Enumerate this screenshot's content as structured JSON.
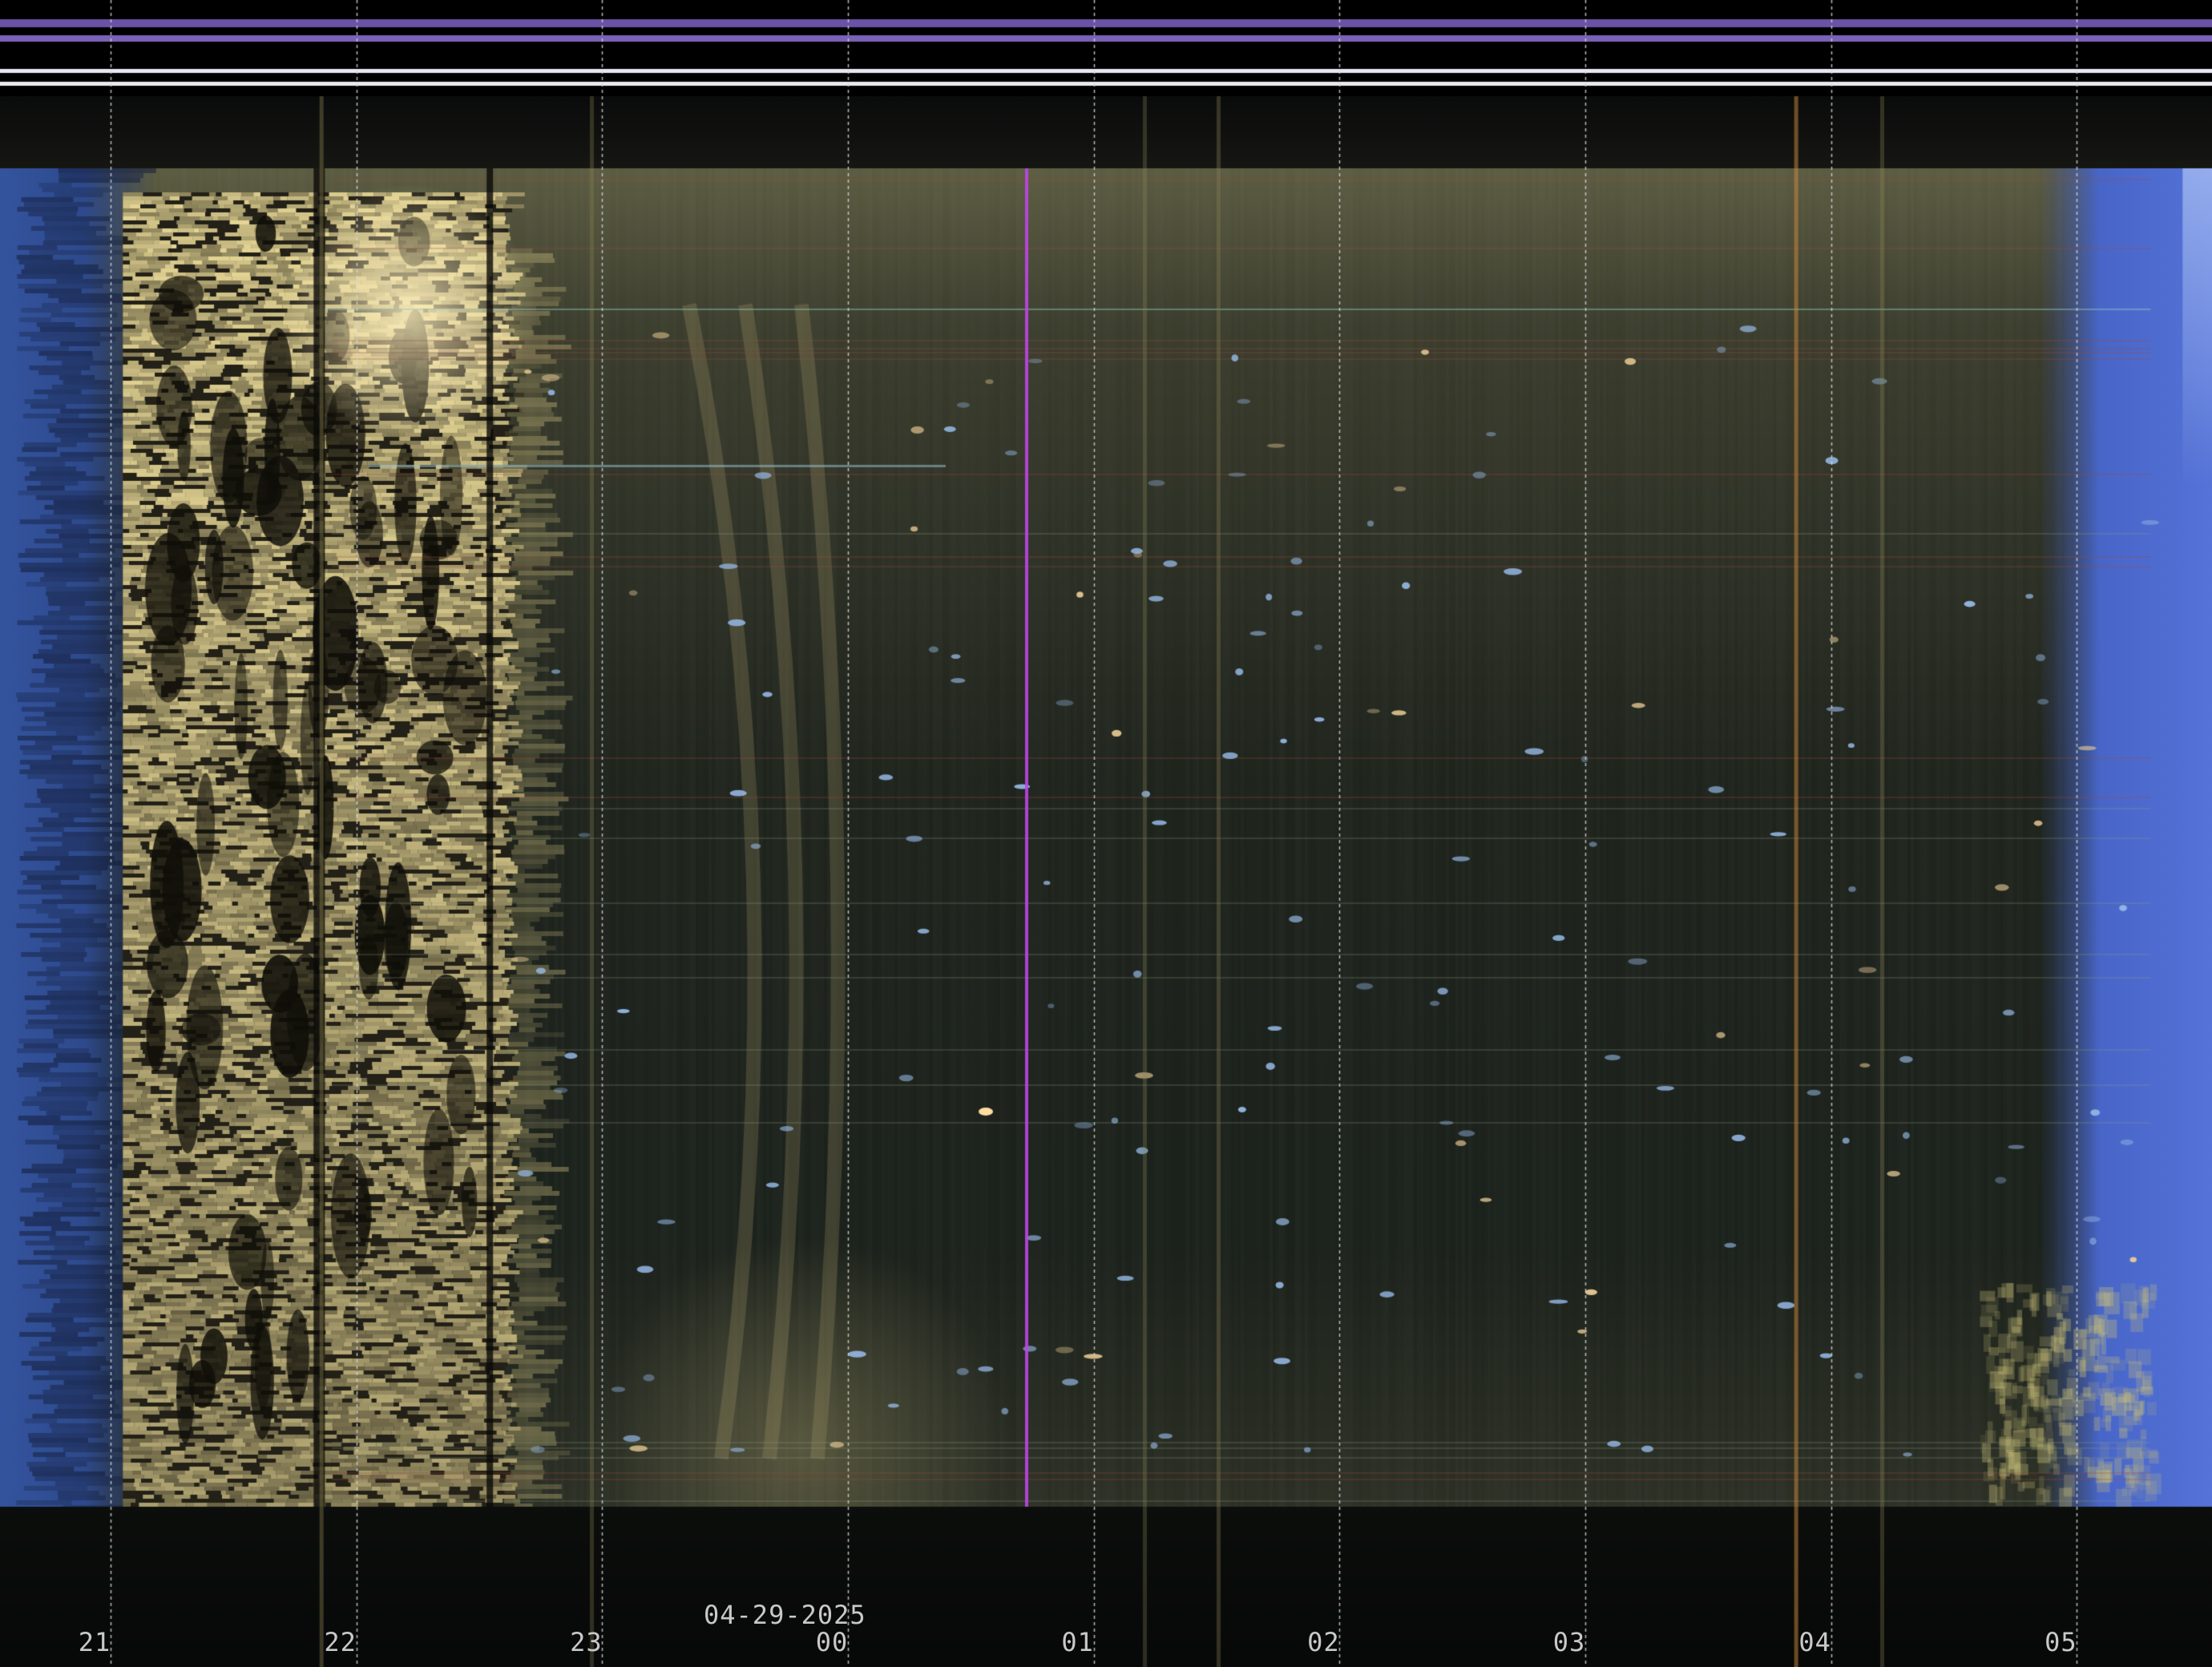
{
  "chart_data": {
    "type": "heatmap",
    "title": "",
    "xlabel": "",
    "ylabel": "",
    "date_label": "04-29-2025",
    "x_ticks": [
      "21",
      "22",
      "23",
      "00",
      "01",
      "02",
      "03",
      "04",
      "05"
    ],
    "x_tick_hours": [
      21,
      22,
      23,
      24,
      25,
      26,
      27,
      28,
      29
    ],
    "x_range_hours": [
      20.55,
      29.55
    ],
    "grid": true,
    "twilight_color": "#4a6fd8",
    "sky_color": "#1c2118",
    "aurora_color": "#e8d89a",
    "top_band_color": "#6a52a6",
    "aurora_features": [
      {
        "from_hour": 21.05,
        "to_hour": 22.6,
        "intensity": "bright"
      },
      {
        "from_hour": 22.6,
        "to_hour": 23.5,
        "intensity": "faint arcs"
      },
      {
        "from_hour": 28.6,
        "to_hour": 29.5,
        "intensity": "faint patches"
      }
    ]
  }
}
